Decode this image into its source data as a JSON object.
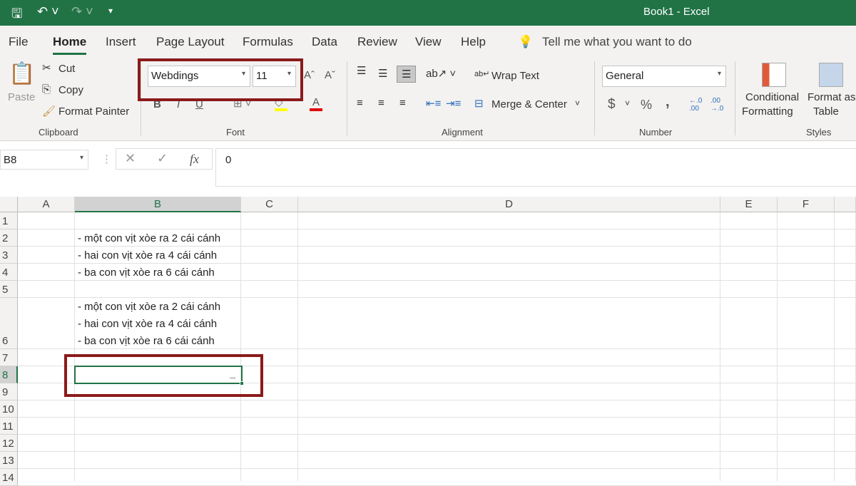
{
  "title_bar": {
    "title": "Book1  -  Excel"
  },
  "menu": {
    "tabs": [
      "File",
      "Home",
      "Insert",
      "Page Layout",
      "Formulas",
      "Data",
      "Review",
      "View",
      "Help"
    ],
    "tell_me": "Tell me what you want to do"
  },
  "ribbon": {
    "clipboard": {
      "paste": "Paste",
      "cut": "Cut",
      "copy": "Copy",
      "format_painter": "Format Painter",
      "label": "Clipboard"
    },
    "font": {
      "font_name": "Webdings",
      "font_size": "11",
      "bold": "B",
      "italic": "I",
      "underline": "U",
      "font_color_glyph": "A",
      "label": "Font",
      "fill_color": "#ffff00",
      "font_color": "#e00000"
    },
    "alignment": {
      "wrap_text": "Wrap Text",
      "merge_center": "Merge & Center",
      "label": "Alignment"
    },
    "number": {
      "format": "General",
      "currency": "$",
      "percent": "%",
      "comma": ",",
      "label": "Number"
    },
    "styles": {
      "conditional_1": "Conditional",
      "conditional_2": "Formatting",
      "format_table_1": "Format as",
      "format_table_2": "Table",
      "label": "Styles"
    }
  },
  "formula_bar": {
    "name_box": "B8",
    "fx": "fx",
    "value": "0"
  },
  "grid": {
    "columns": [
      "A",
      "B",
      "C",
      "D",
      "E",
      "F"
    ],
    "rows": [
      "1",
      "2",
      "3",
      "4",
      "5",
      "6",
      "7",
      "8",
      "9",
      "10",
      "11",
      "12",
      "13",
      "14"
    ],
    "selected_cell": "B8",
    "cells": {
      "B2": "- một con vịt xòe ra 2 cái cánh",
      "B3": "- hai con vịt xòe ra 4 cái cánh",
      "B4": "- ba con vịt xòe ra 6 cái cánh",
      "B6": [
        "- một con vịt xòe ra 2 cái cánh",
        "- hai con vịt xòe ra 4 cái cánh",
        "- ba con vịt xòe ra 6 cái cánh"
      ],
      "B8": "_"
    }
  },
  "colors": {
    "accent": "#217346",
    "highlight_box": "#8b1a1a"
  }
}
